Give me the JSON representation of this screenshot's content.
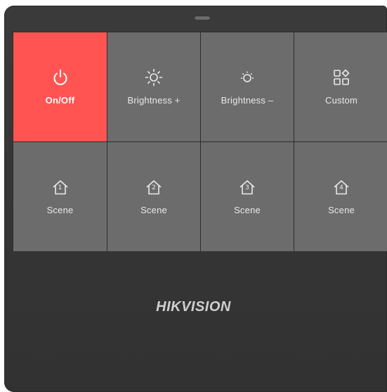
{
  "brand": "HIKVISION",
  "colors": {
    "active_key": "#ff5452",
    "key": "#6c6c6c",
    "panel": "#383838"
  },
  "keys": [
    {
      "label": "On/Off",
      "icon": "power-icon",
      "active": true
    },
    {
      "label": "Brightness +",
      "icon": "brightness-up-icon"
    },
    {
      "label": "Brightness –",
      "icon": "brightness-down-icon"
    },
    {
      "label": "Custom",
      "icon": "custom-icon"
    },
    {
      "label": "Scene",
      "icon": "scene-icon",
      "number": "1"
    },
    {
      "label": "Scene",
      "icon": "scene-icon",
      "number": "2"
    },
    {
      "label": "Scene",
      "icon": "scene-icon",
      "number": "3"
    },
    {
      "label": "Scene",
      "icon": "scene-icon",
      "number": "4"
    }
  ]
}
